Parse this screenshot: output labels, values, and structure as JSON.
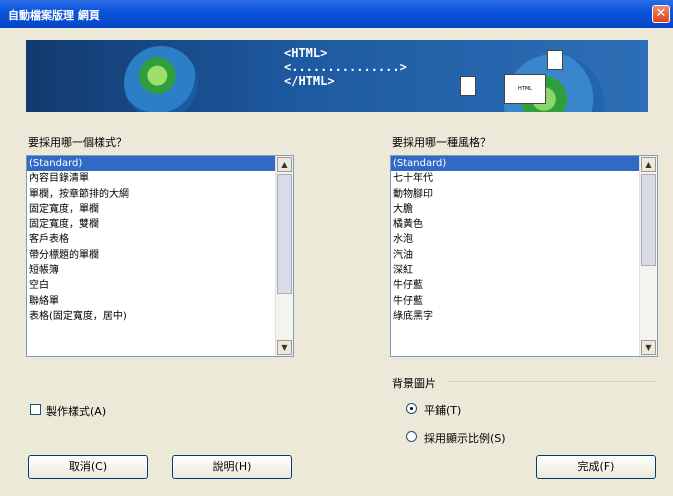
{
  "window": {
    "title": "自動檔案版理 網頁",
    "close_glyph": "✕"
  },
  "banner": {
    "code_lines": [
      "<HTML>",
      "<...............>",
      "</HTML>"
    ],
    "doc_label": "HTML"
  },
  "layout_section": {
    "prompt": "要採用哪一個樣式？",
    "items": [
      "(Standard)",
      "內容目錄清單",
      "單欄，按章節排的大綱",
      "固定寬度，單欄",
      "固定寬度，雙欄",
      "客戶表格",
      "帶分標題的單欄",
      "短帳簿",
      "空白",
      "聯絡單",
      "表格(固定寬度，居中)"
    ],
    "selected_index": 0
  },
  "style_section": {
    "prompt": "要採用哪一種風格？",
    "items": [
      "(Standard)",
      "七十年代",
      "動物腳印",
      "大膽",
      "橘黃色",
      "水泡",
      "汽油",
      "深紅",
      "牛仔藍",
      "牛仔藍",
      "綠底黑字"
    ],
    "selected_index": 0
  },
  "background_image": {
    "label": "背景圖片",
    "options": [
      {
        "label": "平鋪(T)",
        "selected": true
      },
      {
        "label": "採用顯示比例(S)",
        "selected": false
      }
    ]
  },
  "customize_checkbox": {
    "label": "製作樣式(A)",
    "checked": false
  },
  "buttons": {
    "cancel": "取消(C)",
    "help": "說明(H)",
    "finish": "完成(F)"
  }
}
